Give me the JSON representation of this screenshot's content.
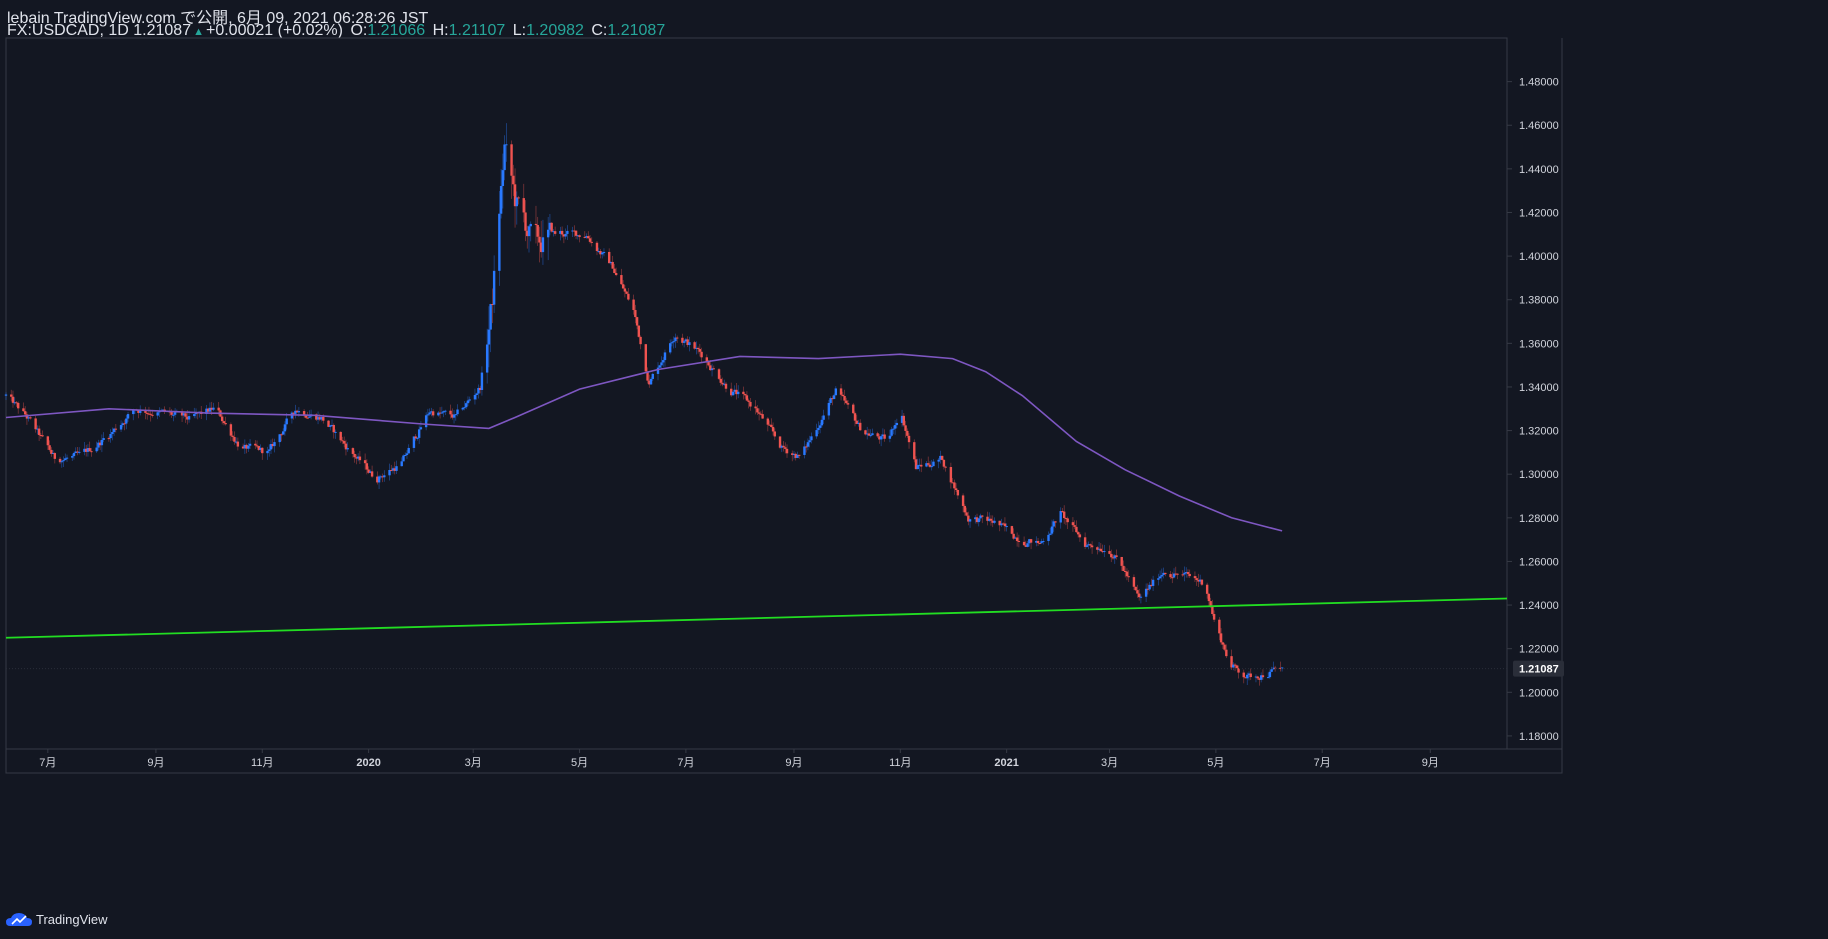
{
  "header": {
    "published_line": "lebain TradingView.com で公開, 6月 09, 2021 06:28:26 JST",
    "symbol": "FX:USDCAD, 1D",
    "last": "1.21087",
    "change": "+0.00021 (+0.02%)",
    "o_label": "O:",
    "o": "1.21066",
    "h_label": "H:",
    "h": "1.21107",
    "l_label": "L:",
    "l": "1.20982",
    "c_label": "C:",
    "c": "1.21087"
  },
  "footer": {
    "brand": "TradingView"
  },
  "colors": {
    "background": "#131722",
    "up": "#2979ff",
    "down": "#ef5350",
    "ma": "#7e57c2",
    "trendline": "#22dd22",
    "axis_text": "#d1d4dc",
    "border": "#363a45"
  },
  "chart_data": {
    "type": "candlestick",
    "symbol": "USDCAD",
    "interval": "1D",
    "y_ticks": [
      "1.48000",
      "1.46000",
      "1.44000",
      "1.42000",
      "1.40000",
      "1.38000",
      "1.36000",
      "1.34000",
      "1.32000",
      "1.30000",
      "1.28000",
      "1.26000",
      "1.24000",
      "1.22000",
      "1.20000",
      "1.18000"
    ],
    "ylim": [
      1.174,
      1.5
    ],
    "x_ticks": [
      "7月",
      "9月",
      "11月",
      "2020",
      "3月",
      "5月",
      "7月",
      "9月",
      "11月",
      "2021",
      "3月",
      "5月",
      "7月",
      "9月"
    ],
    "x_range": [
      "2019-06-07",
      "2021-10-15"
    ],
    "last_price_label": "1.21087",
    "last_price": 1.21087,
    "price_path": [
      [
        "2019-06-07",
        1.336
      ],
      [
        "2019-06-20",
        1.325
      ],
      [
        "2019-07-05",
        1.307
      ],
      [
        "2019-07-20",
        1.308
      ],
      [
        "2019-08-05",
        1.318
      ],
      [
        "2019-08-20",
        1.33
      ],
      [
        "2019-09-05",
        1.328
      ],
      [
        "2019-09-20",
        1.325
      ],
      [
        "2019-10-05",
        1.33
      ],
      [
        "2019-10-20",
        1.312
      ],
      [
        "2019-11-05",
        1.31
      ],
      [
        "2019-11-20",
        1.33
      ],
      [
        "2019-12-05",
        1.326
      ],
      [
        "2019-12-20",
        1.312
      ],
      [
        "2020-01-05",
        1.298
      ],
      [
        "2020-01-20",
        1.305
      ],
      [
        "2020-02-05",
        1.329
      ],
      [
        "2020-02-20",
        1.326
      ],
      [
        "2020-03-05",
        1.34
      ],
      [
        "2020-03-12",
        1.38
      ],
      [
        "2020-03-19",
        1.45
      ],
      [
        "2020-03-25",
        1.425
      ],
      [
        "2020-04-05",
        1.405
      ],
      [
        "2020-04-20",
        1.41
      ],
      [
        "2020-05-05",
        1.41
      ],
      [
        "2020-05-20",
        1.395
      ],
      [
        "2020-06-01",
        1.375
      ],
      [
        "2020-06-10",
        1.342
      ],
      [
        "2020-06-25",
        1.365
      ],
      [
        "2020-07-10",
        1.355
      ],
      [
        "2020-07-25",
        1.34
      ],
      [
        "2020-08-10",
        1.33
      ],
      [
        "2020-08-25",
        1.312
      ],
      [
        "2020-09-05",
        1.308
      ],
      [
        "2020-09-25",
        1.338
      ],
      [
        "2020-10-10",
        1.32
      ],
      [
        "2020-10-25",
        1.315
      ],
      [
        "2020-11-01",
        1.33
      ],
      [
        "2020-11-10",
        1.303
      ],
      [
        "2020-11-25",
        1.307
      ],
      [
        "2020-12-10",
        1.28
      ],
      [
        "2020-12-25",
        1.278
      ],
      [
        "2021-01-05",
        1.272
      ],
      [
        "2021-01-20",
        1.268
      ],
      [
        "2021-02-01",
        1.282
      ],
      [
        "2021-02-15",
        1.268
      ],
      [
        "2021-03-01",
        1.266
      ],
      [
        "2021-03-10",
        1.255
      ],
      [
        "2021-03-18",
        1.242
      ],
      [
        "2021-04-01",
        1.256
      ],
      [
        "2021-04-15",
        1.253
      ],
      [
        "2021-04-25",
        1.25
      ],
      [
        "2021-05-01",
        1.23
      ],
      [
        "2021-05-10",
        1.212
      ],
      [
        "2021-05-20",
        1.207
      ],
      [
        "2021-06-08",
        1.2109
      ]
    ],
    "ma_path": [
      [
        "2019-06-07",
        1.326
      ],
      [
        "2019-08-05",
        1.33
      ],
      [
        "2019-10-01",
        1.328
      ],
      [
        "2019-12-01",
        1.327
      ],
      [
        "2020-02-01",
        1.323
      ],
      [
        "2020-03-10",
        1.321
      ],
      [
        "2020-03-25",
        1.326
      ],
      [
        "2020-05-01",
        1.339
      ],
      [
        "2020-06-15",
        1.348
      ],
      [
        "2020-08-01",
        1.354
      ],
      [
        "2020-09-15",
        1.353
      ],
      [
        "2020-11-01",
        1.355
      ],
      [
        "2020-12-01",
        1.353
      ],
      [
        "2020-12-20",
        1.347
      ],
      [
        "2021-01-10",
        1.336
      ],
      [
        "2021-02-10",
        1.315
      ],
      [
        "2021-03-10",
        1.302
      ],
      [
        "2021-04-10",
        1.29
      ],
      [
        "2021-05-10",
        1.28
      ],
      [
        "2021-06-08",
        1.274
      ]
    ],
    "trendline": [
      [
        "2019-06-07",
        1.225
      ],
      [
        "2021-10-15",
        1.243
      ]
    ],
    "series": [
      {
        "name": "USDCAD",
        "kind": "candles"
      },
      {
        "name": "",
        "kind": "moving-average-line"
      },
      {
        "name": "",
        "kind": "trendline"
      }
    ]
  }
}
